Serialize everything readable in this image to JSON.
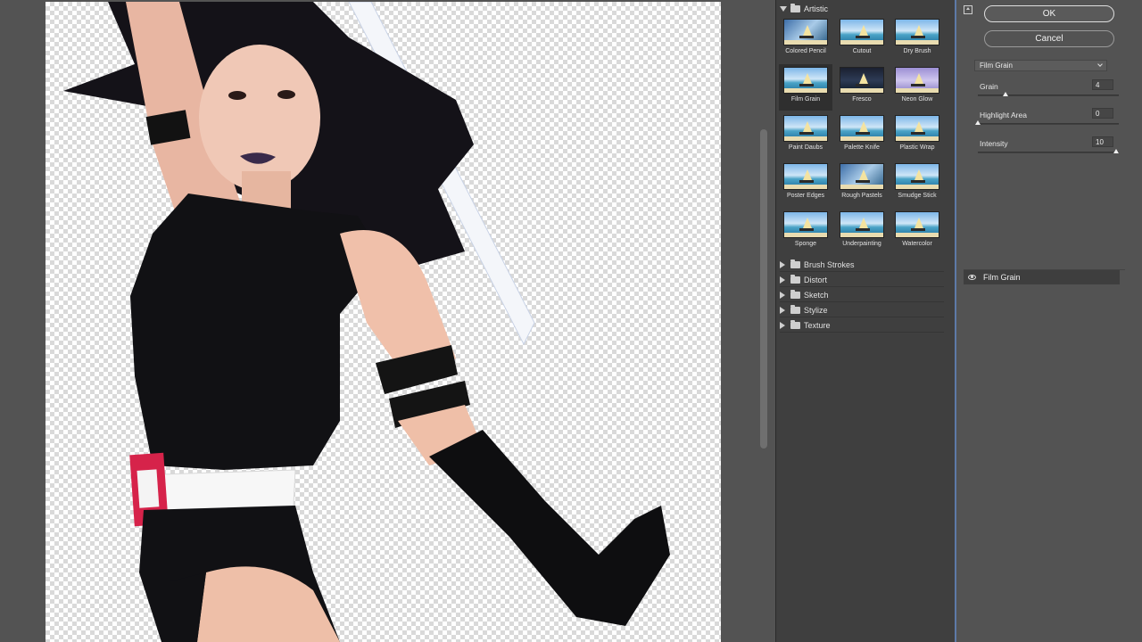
{
  "dialog": {
    "ok_label": "OK",
    "cancel_label": "Cancel"
  },
  "gallery": {
    "open_category": "Artistic",
    "filters": [
      {
        "label": "Colored Pencil",
        "style": "pencil"
      },
      {
        "label": "Cutout",
        "style": "normal"
      },
      {
        "label": "Dry Brush",
        "style": "normal"
      },
      {
        "label": "Film Grain",
        "style": "normal",
        "selected": true
      },
      {
        "label": "Fresco",
        "style": "dark"
      },
      {
        "label": "Neon Glow",
        "style": "neon"
      },
      {
        "label": "Paint Daubs",
        "style": "normal"
      },
      {
        "label": "Palette Knife",
        "style": "normal"
      },
      {
        "label": "Plastic Wrap",
        "style": "normal"
      },
      {
        "label": "Poster Edges",
        "style": "normal"
      },
      {
        "label": "Rough Pastels",
        "style": "pencil"
      },
      {
        "label": "Smudge Stick",
        "style": "normal"
      },
      {
        "label": "Sponge",
        "style": "normal"
      },
      {
        "label": "Underpainting",
        "style": "normal"
      },
      {
        "label": "Watercolor",
        "style": "normal"
      }
    ],
    "collapsed_categories": [
      "Brush Strokes",
      "Distort",
      "Sketch",
      "Stylize",
      "Texture"
    ]
  },
  "settings": {
    "selected_filter": "Film Grain",
    "params": [
      {
        "label": "Grain",
        "value": "4",
        "level": 0.2
      },
      {
        "label": "Highlight Area",
        "value": "0",
        "level": 0.0
      },
      {
        "label": "Intensity",
        "value": "10",
        "level": 1.0
      }
    ]
  },
  "layers": {
    "effect_layer": "Film Grain"
  },
  "colors": {
    "panel_bg": "#535353",
    "gallery_bg": "#3f3f3f",
    "accent_border": "#5d7aa8",
    "belt_red": "#d6234a"
  }
}
